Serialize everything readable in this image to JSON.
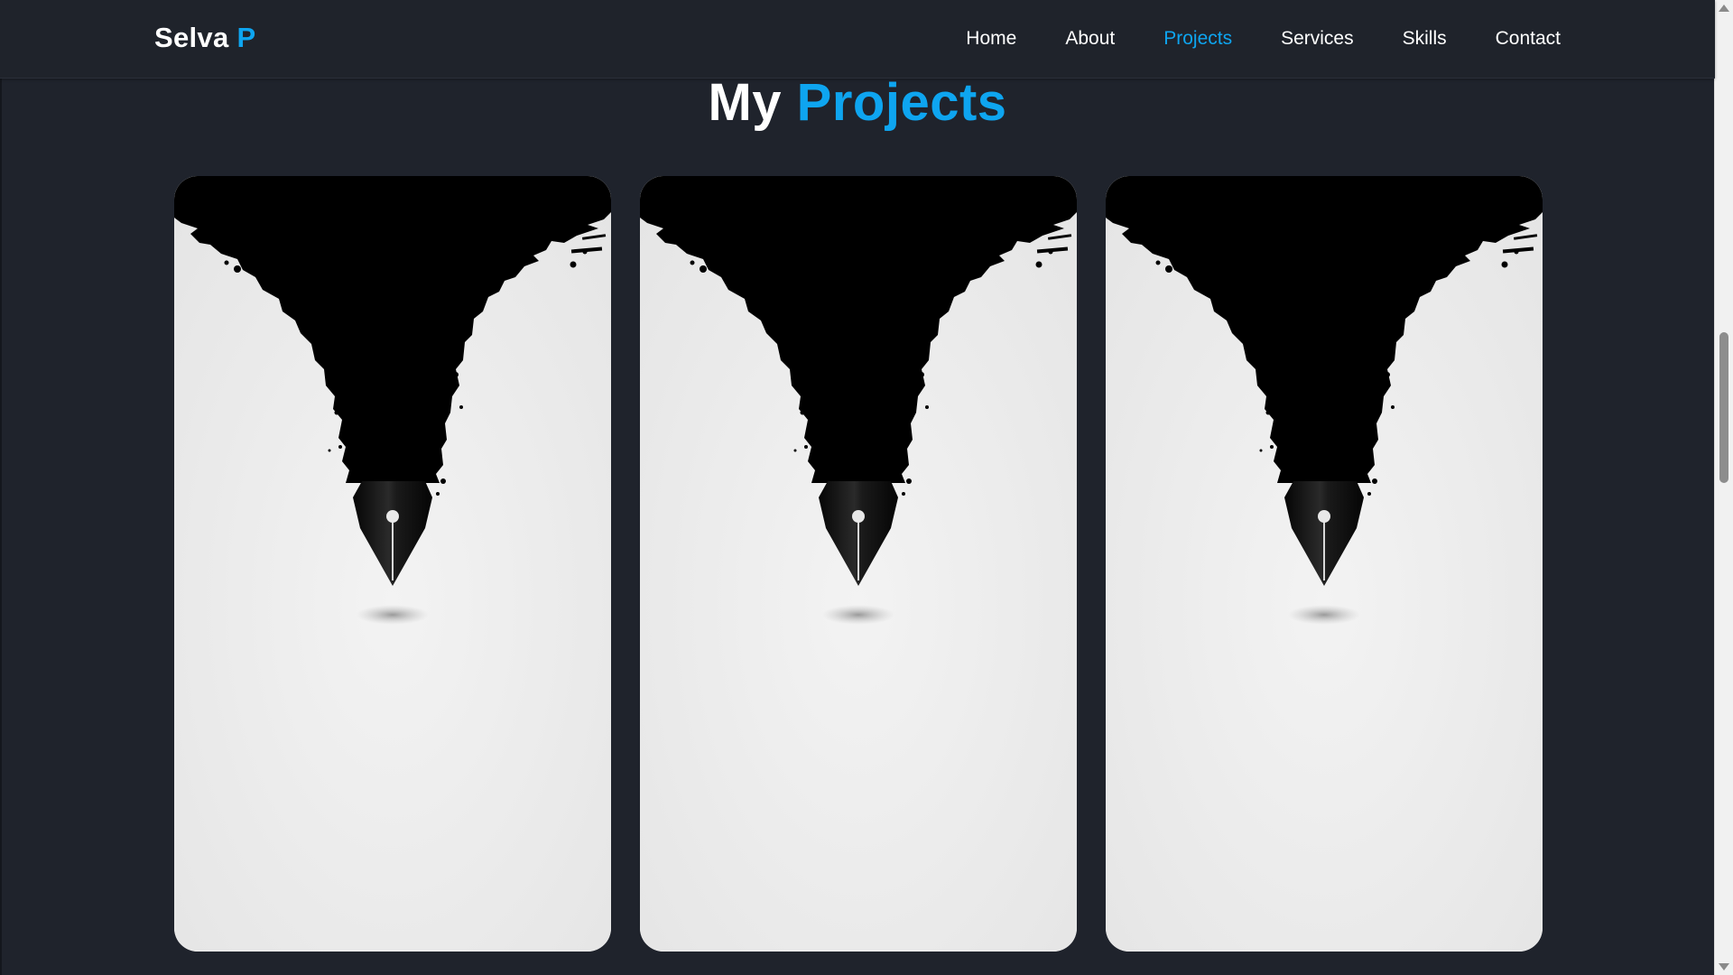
{
  "brand": {
    "name": "Selva",
    "initial": "P"
  },
  "nav": {
    "items": [
      {
        "label": "Home",
        "active": false
      },
      {
        "label": "About",
        "active": false
      },
      {
        "label": "Projects",
        "active": true
      },
      {
        "label": "Services",
        "active": false
      },
      {
        "label": "Skills",
        "active": false
      },
      {
        "label": "Contact",
        "active": false
      }
    ]
  },
  "section": {
    "title_prefix": "My",
    "title_accent": "Projects"
  },
  "projects": [
    {
      "image": "ink-pen-nib-illustration"
    },
    {
      "image": "ink-pen-nib-illustration"
    },
    {
      "image": "ink-pen-nib-illustration"
    }
  ],
  "colors": {
    "background": "#1f232c",
    "accent": "#0ea5f0",
    "text": "#ffffff",
    "card_paper": "#eeeeee"
  },
  "scrollbar": {
    "position_fraction": 0.34
  }
}
